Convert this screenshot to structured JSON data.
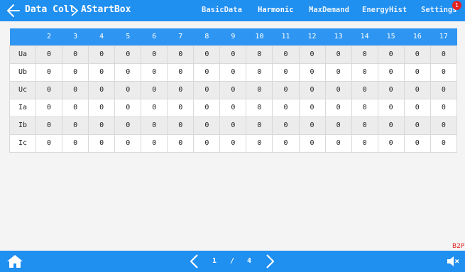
{
  "header": {
    "crumb_parent": "Data Coll",
    "crumb_current": "AStartBox",
    "tabs": [
      "BasicData",
      "Harmonic",
      "MaxDemand",
      "EnergyHist",
      "Settings"
    ],
    "active_tab": "Harmonic",
    "notification_count": "1"
  },
  "table": {
    "columns": [
      "",
      "2",
      "3",
      "4",
      "5",
      "6",
      "7",
      "8",
      "9",
      "10",
      "11",
      "12",
      "13",
      "14",
      "15",
      "16",
      "17"
    ],
    "rows": [
      {
        "label": "Ua",
        "values": [
          "0",
          "0",
          "0",
          "0",
          "0",
          "0",
          "0",
          "0",
          "0",
          "0",
          "0",
          "0",
          "0",
          "0",
          "0",
          "0"
        ]
      },
      {
        "label": "Ub",
        "values": [
          "0",
          "0",
          "0",
          "0",
          "0",
          "0",
          "0",
          "0",
          "0",
          "0",
          "0",
          "0",
          "0",
          "0",
          "0",
          "0"
        ]
      },
      {
        "label": "Uc",
        "values": [
          "0",
          "0",
          "0",
          "0",
          "0",
          "0",
          "0",
          "0",
          "0",
          "0",
          "0",
          "0",
          "0",
          "0",
          "0",
          "0"
        ]
      },
      {
        "label": "Ia",
        "values": [
          "0",
          "0",
          "0",
          "0",
          "0",
          "0",
          "0",
          "0",
          "0",
          "0",
          "0",
          "0",
          "0",
          "0",
          "0",
          "0"
        ]
      },
      {
        "label": "Ib",
        "values": [
          "0",
          "0",
          "0",
          "0",
          "0",
          "0",
          "0",
          "0",
          "0",
          "0",
          "0",
          "0",
          "0",
          "0",
          "0",
          "0"
        ]
      },
      {
        "label": "Ic",
        "values": [
          "0",
          "0",
          "0",
          "0",
          "0",
          "0",
          "0",
          "0",
          "0",
          "0",
          "0",
          "0",
          "0",
          "0",
          "0",
          "0"
        ]
      }
    ]
  },
  "footer": {
    "page_current": "1",
    "page_separator": "/",
    "page_total": "4",
    "tag": "B2P"
  },
  "icons": {
    "back": "arrow-left-icon",
    "separator": "chevron-right-icon",
    "home": "home-icon",
    "prev": "chevron-left-icon",
    "next": "chevron-right-icon",
    "mute": "speaker-mute-icon"
  },
  "colors": {
    "bar": "#1f8ff0",
    "table_header": "#2e95f2",
    "badge": "#e32222"
  }
}
